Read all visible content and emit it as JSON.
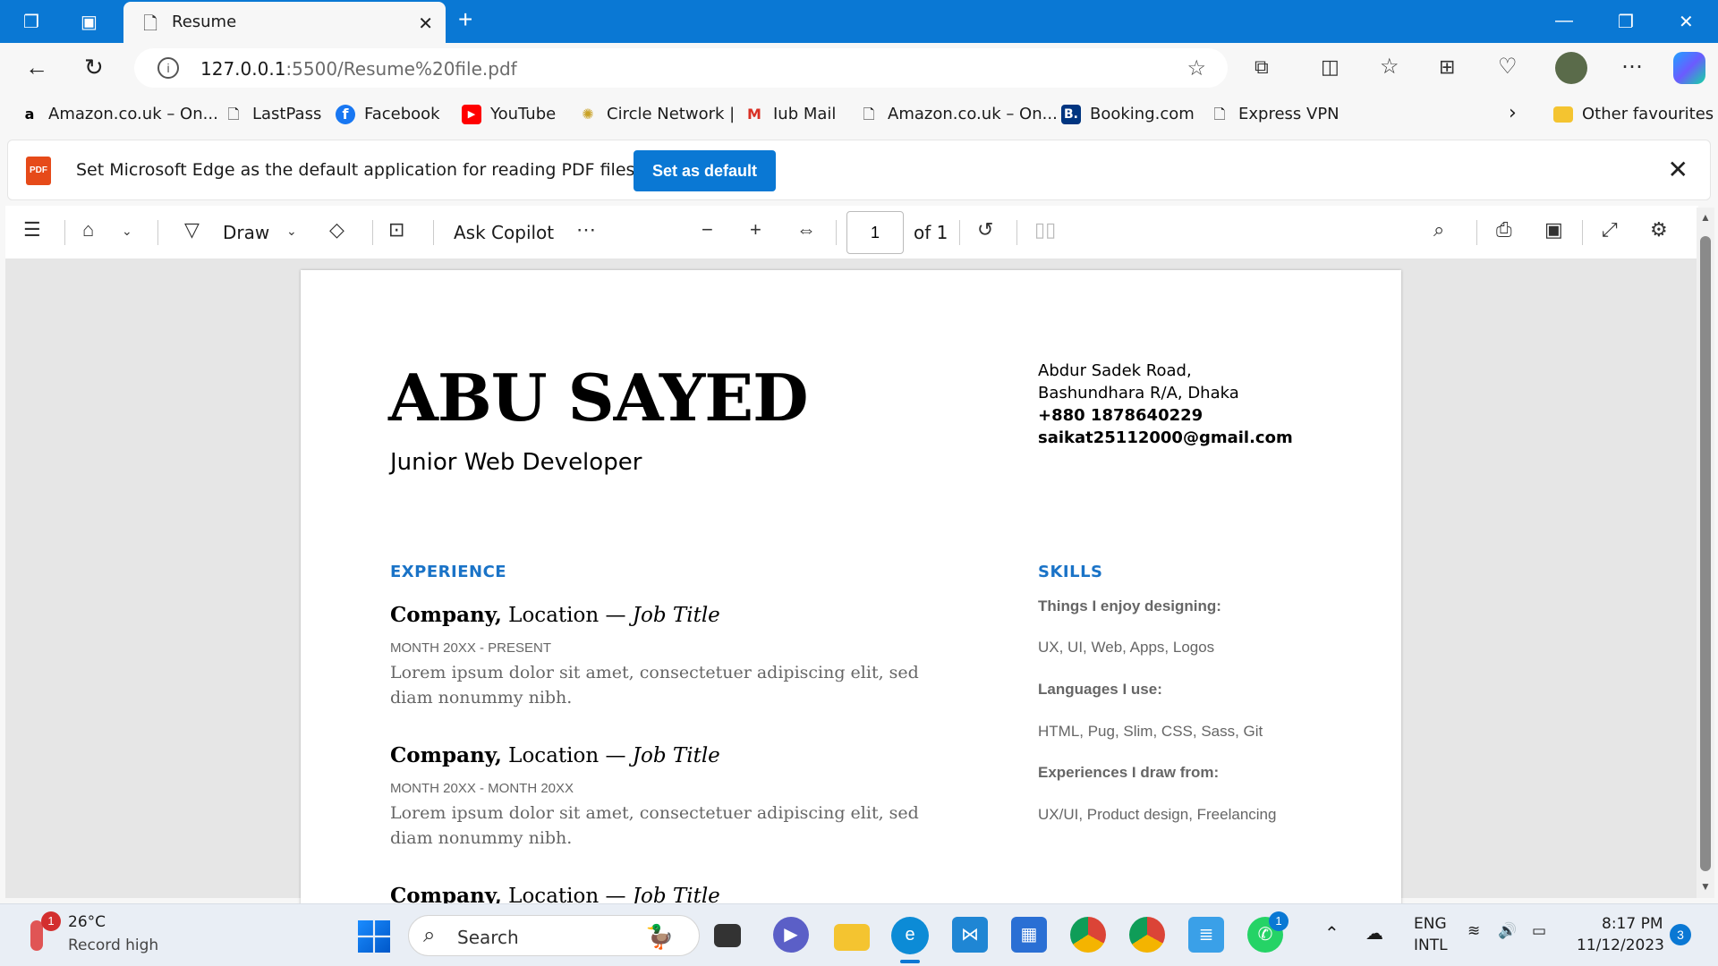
{
  "browser": {
    "tab_title": "Resume",
    "url_host": "127.0.0.1",
    "url_path": ":5500/Resume%20file.pdf"
  },
  "favourites": [
    {
      "label": "Amazon.co.uk – On...",
      "icon": "amazon-icon"
    },
    {
      "label": "LastPass",
      "icon": "page-icon"
    },
    {
      "label": "Facebook",
      "icon": "facebook-icon"
    },
    {
      "label": "YouTube",
      "icon": "youtube-icon"
    },
    {
      "label": "Circle Network |",
      "icon": "circle-network-icon"
    },
    {
      "label": "Iub Mail",
      "icon": "gmail-icon"
    },
    {
      "label": "Amazon.co.uk – On...",
      "icon": "page-icon"
    },
    {
      "label": "Booking.com",
      "icon": "booking-icon"
    },
    {
      "label": "Express VPN",
      "icon": "page-icon"
    }
  ],
  "other_favourites": "Other favourites",
  "infobar": {
    "message": "Set Microsoft Edge as the default application for reading PDF files?",
    "button": "Set as default"
  },
  "pdf_toolbar": {
    "draw": "Draw",
    "ask_copilot": "Ask Copilot",
    "page_number": "1",
    "page_total": "of 1"
  },
  "resume": {
    "name": "ABU SAYED",
    "role": "Junior Web Developer",
    "address1": "Abdur Sadek Road,",
    "address2": "Bashundhara R/A, Dhaka",
    "phone": "+880 1878640229",
    "email": "saikat25112000@gmail.com",
    "experience_heading": "EXPERIENCE",
    "jobs": [
      {
        "company": "Company,",
        "location": " Location — ",
        "title": "Job Title",
        "dates": "MONTH 20XX - PRESENT",
        "desc": "Lorem ipsum dolor sit amet, consectetuer adipiscing elit, sed diam nonummy nibh."
      },
      {
        "company": "Company,",
        "location": " Location — ",
        "title": "Job Title",
        "dates": "MONTH 20XX - MONTH 20XX",
        "desc": "Lorem ipsum dolor sit amet, consectetuer adipiscing elit, sed diam nonummy nibh."
      },
      {
        "company": "Company,",
        "location": " Location — ",
        "title": "Job Title"
      }
    ],
    "skills_heading": "SKILLS",
    "skills": [
      {
        "heading": "Things I enjoy designing:",
        "value": "UX, UI, Web, Apps, Logos"
      },
      {
        "heading": "Languages I use:",
        "value": "HTML, Pug, Slim, CSS, Sass, Git"
      },
      {
        "heading": "Experiences I draw from:",
        "value": "UX/UI, Product design, Freelancing"
      }
    ]
  },
  "taskbar": {
    "weather_temp": "26°C",
    "weather_desc": "Record high",
    "weather_badge": "1",
    "search": "Search",
    "whatsapp_badge": "1",
    "lang1": "ENG",
    "lang2": "INTL",
    "time": "8:17 PM",
    "date": "11/12/2023",
    "notif_count": "3"
  },
  "colors": {
    "accent": "#0a78d4",
    "resume_heading": "#1a73c7"
  }
}
